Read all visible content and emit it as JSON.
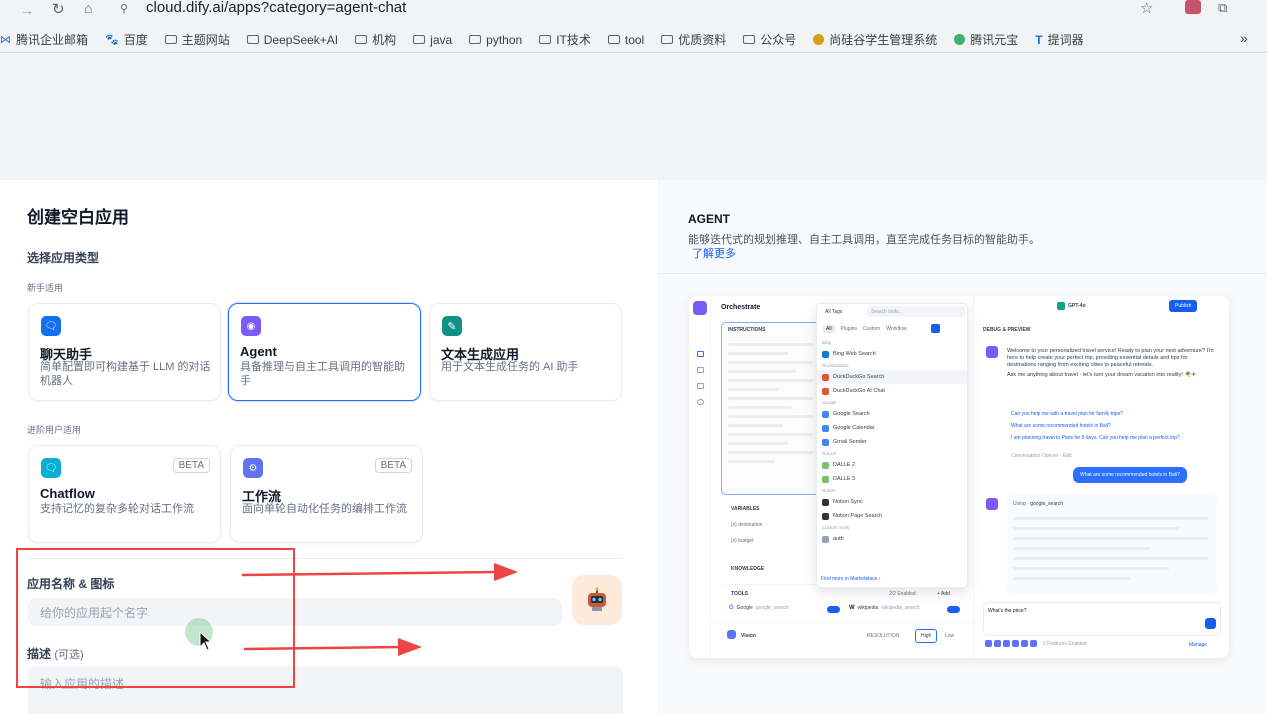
{
  "browser": {
    "url": "cloud.dify.ai/apps?category=agent-chat",
    "bookmarks": [
      "腾讯企业邮箱",
      "百度",
      "主题网站",
      "DeepSeek+AI",
      "机构",
      "java",
      "python",
      "IT技术",
      "tool",
      "优质资料",
      "公众号",
      "尚硅谷学生管理系统",
      "腾讯元宝",
      "提词器"
    ],
    "more": "»"
  },
  "create": {
    "title": "创建空白应用",
    "type_label": "选择应用类型",
    "beginner_label": "新手适用",
    "advanced_label": "进阶用户适用",
    "cards": [
      {
        "title": "聊天助手",
        "desc": "简单配置即可构建基于 LLM 的对话机器人"
      },
      {
        "title": "Agent",
        "desc": "具备推理与自主工具调用的智能助手"
      },
      {
        "title": "文本生成应用",
        "desc": "用于文本生成任务的 AI 助手"
      },
      {
        "title": "Chatflow",
        "desc": "支持记忆的复杂多轮对话工作流",
        "badge": "BETA"
      },
      {
        "title": "工作流",
        "desc": "面向单轮自动化任务的编排工作流",
        "badge": "BETA"
      }
    ],
    "name_label": "应用名称 & 图标",
    "name_placeholder": "给你的应用起个名字",
    "desc_label": "描述",
    "desc_optional": "(可选)",
    "desc_placeholder": "输入应用的描述"
  },
  "preview": {
    "heading": "AGENT",
    "desc": "能够迭代式的规划推理、自主工具调用，直至完成任务目标的智能助手。",
    "learn_more": "了解更多",
    "orchestrate": "Orchestrate",
    "instructions": "INSTRUCTIONS",
    "variables": "VARIABLES",
    "knowledge": "KNOWLEDGE",
    "tools": "TOOLS",
    "tools_enabled": "2/2 Enabled",
    "add": "+ Add",
    "tool1": "Google",
    "tool1_sub": "google_search",
    "tool2": "wikipedia",
    "tool2_sub": "wikipedia_search",
    "var1": "{x} destination",
    "var2": "{x} budget",
    "vision": "Vision",
    "resolution": "RESOLUTION",
    "high": "High",
    "low": "Low",
    "model": "GPT-4o",
    "publish": "Publish",
    "debug": "DEBUG & PREVIEW",
    "welcome": "Welcome to your personalized travel service! Ready to plan your next adventure? I'm here to help create your perfect trip, providing essential details and tips for destinations ranging from exciting cities to peaceful retreats.",
    "ask": "Ask me anything about travel - let's turn your dream vacation into reality! 🌴✈",
    "sugg": [
      "Can you help me with a travel plan for family trips?",
      "What are some recommended hotels in Bali?",
      "I am planning travel to Paris for 5 days. Can you help me plan a perfect trip?"
    ],
    "conv_opener": "Conversation Opener · Edit",
    "user_msg": "What are some recommended hotels in Bali?",
    "using": "Using",
    "using_tool": "google_search",
    "input": "What's the price?",
    "features": "5 Features Enabled",
    "manage": "Manage",
    "dd": {
      "tags": "All Tags",
      "search": "Search tools...",
      "tabs": [
        "All",
        "Plugins",
        "Custom",
        "Workflow"
      ],
      "groups": [
        {
          "name": "Bing",
          "items": [
            "Bing Web Search"
          ]
        },
        {
          "name": "DuckDuckGo",
          "items": [
            "DuckDuckGo Search",
            "DuckDuckGo AI Chat"
          ]
        },
        {
          "name": "Google",
          "items": [
            "Google Search",
            "Google Calendar",
            "Gmail Sender"
          ]
        },
        {
          "name": "DALLE",
          "items": [
            "DALLE 2",
            "DALLE 3"
          ]
        },
        {
          "name": "Notion",
          "items": [
            "Notion Sync",
            "Notion Page Search"
          ]
        },
        {
          "name": "Custom Tools",
          "items": [
            "auth"
          ]
        }
      ],
      "more": "Find more in Marketplace ›"
    }
  }
}
